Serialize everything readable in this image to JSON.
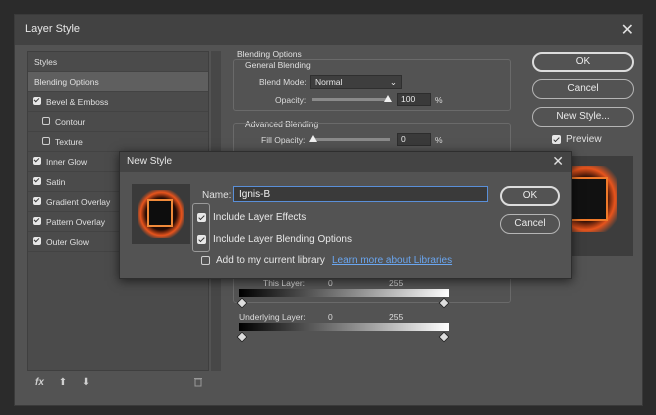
{
  "main_dialog": {
    "title": "Layer Style",
    "close_glyph": "✕"
  },
  "styles_list": {
    "items": [
      {
        "label": "Styles",
        "checkbox": "none",
        "active": false
      },
      {
        "label": "Blending Options",
        "checkbox": "none",
        "active": true
      },
      {
        "label": "Bevel & Emboss",
        "checkbox": "checked",
        "active": false
      },
      {
        "label": "Contour",
        "checkbox": "empty",
        "active": false
      },
      {
        "label": "Texture",
        "checkbox": "empty",
        "active": false
      },
      {
        "label": "Inner Glow",
        "checkbox": "checked",
        "active": false
      },
      {
        "label": "Satin",
        "checkbox": "checked",
        "active": false
      },
      {
        "label": "Gradient Overlay",
        "checkbox": "checked",
        "active": false
      },
      {
        "label": "Pattern Overlay",
        "checkbox": "checked",
        "active": false
      },
      {
        "label": "Outer Glow",
        "checkbox": "checked",
        "active": false
      }
    ],
    "toolbar": {
      "fx_label": "fx",
      "up_glyph": "⬆",
      "down_glyph": "⬇"
    }
  },
  "blending_options": {
    "title": "Blending Options",
    "general": {
      "title": "General Blending",
      "blend_mode_label": "Blend Mode:",
      "blend_mode_value": "Normal",
      "opacity_label": "Opacity:",
      "opacity_value": "100",
      "opacity_unit": "%"
    },
    "advanced": {
      "title": "Advanced Blending",
      "fill_opacity_label": "Fill Opacity:",
      "fill_opacity_value": "0",
      "fill_opacity_unit": "%"
    },
    "blend_if": {
      "this_layer_label": "This Layer:",
      "this_layer_low": "0",
      "this_layer_high": "255",
      "underlying_label": "Underlying Layer:",
      "underlying_low": "0",
      "underlying_high": "255"
    }
  },
  "right_panel": {
    "ok_label": "OK",
    "cancel_label": "Cancel",
    "new_style_label": "New Style...",
    "preview_label": "Preview"
  },
  "new_style_dialog": {
    "title": "New Style",
    "close_glyph": "✕",
    "name_label": "Name:",
    "name_value": "Ignis-B",
    "include_effects_label": "Include Layer Effects",
    "include_blending_label": "Include Layer Blending Options",
    "add_library_label": "Add to my current library",
    "learn_more_link": "Learn more about Libraries",
    "ok_label": "OK",
    "cancel_label": "Cancel"
  },
  "colors": {
    "dialog_bg": "#535353",
    "title_bg": "#424242",
    "link": "#6aa6f0",
    "glow": "#e8541c"
  }
}
